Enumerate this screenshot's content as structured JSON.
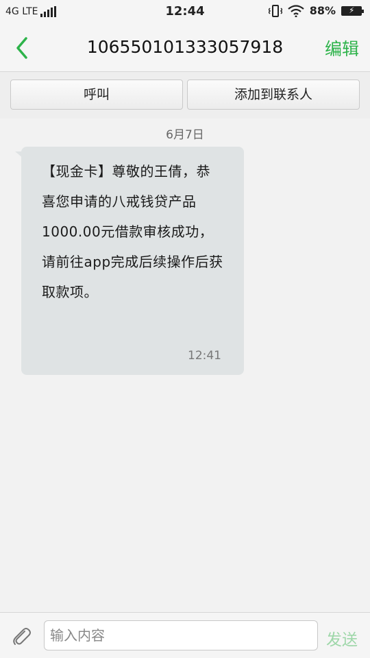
{
  "status_bar": {
    "network": "4G LTE",
    "time": "12:44",
    "battery": "88%"
  },
  "header": {
    "title": "106550101333057918",
    "edit_label": "编辑"
  },
  "actions": {
    "call_label": "呼叫",
    "add_contact_label": "添加到联系人"
  },
  "conversation": {
    "date": "6月7日",
    "messages": [
      {
        "text": "【现金卡】尊敬的王倩，恭喜您申请的八戒钱贷产品1000.00元借款审核成功，请前往app完成后续操作后获取款项。",
        "time": "12:41"
      }
    ]
  },
  "input_bar": {
    "placeholder": "输入内容",
    "send_label": "发送"
  },
  "colors": {
    "accent": "#2db34a",
    "send_disabled": "#9ed7a9",
    "bubble": "#dfe3e4"
  }
}
